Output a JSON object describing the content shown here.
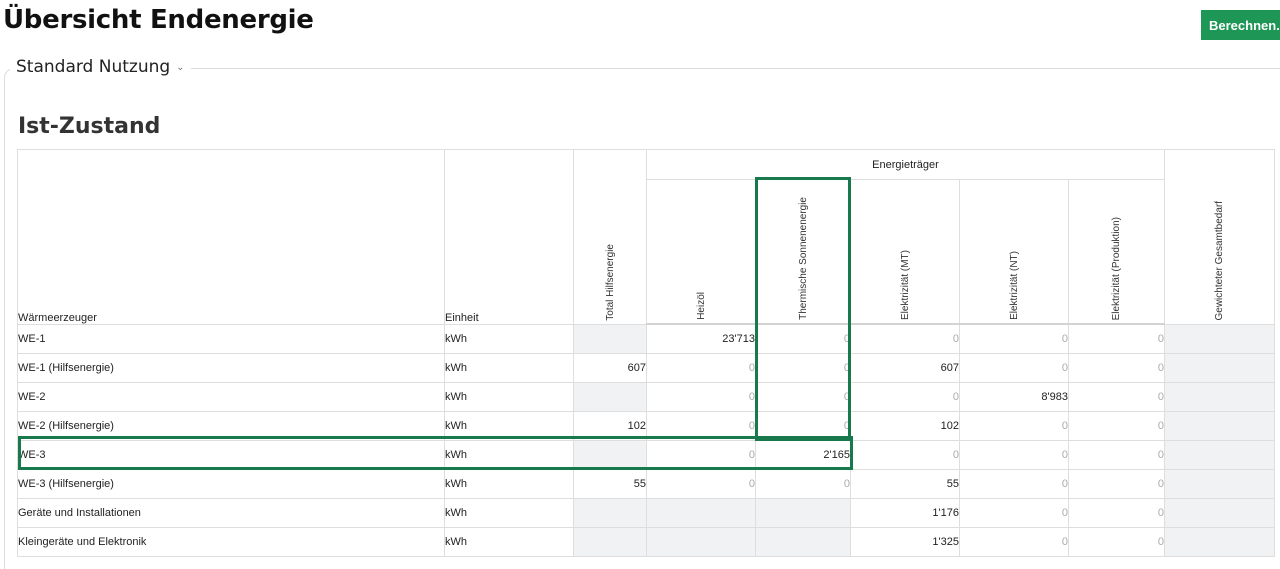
{
  "page": {
    "title": "Übersicht Endenergie"
  },
  "toolbar": {
    "calculate_label": "Berechnen..."
  },
  "usage": {
    "selected": "Standard Nutzung"
  },
  "section": {
    "title": "Ist-Zustand"
  },
  "table": {
    "headers": {
      "heat_generator": "Wärmeerzeuger",
      "unit": "Einheit",
      "total_aux": "Total Hilfsenergie",
      "group": "Energieträger",
      "heizoel": "Heizöl",
      "solar_thermal": "Thermische Sonnenenergie",
      "elec_mt": "Elektrizität (MT)",
      "elec_nt": "Elektrizität (NT)",
      "elec_prod": "Elektrizität (Produktion)",
      "weighted_total": "Gewichteter Gesamtbedarf"
    },
    "rows": [
      {
        "name": "WE-1",
        "unit": "kWh",
        "total": "",
        "heizoel": "23'713",
        "solar": "0",
        "mt": "0",
        "nt": "0",
        "prod": "0"
      },
      {
        "name": "WE-1 (Hilfsenergie)",
        "unit": "kWh",
        "total": "607",
        "heizoel": "0",
        "solar": "0",
        "mt": "607",
        "nt": "0",
        "prod": "0"
      },
      {
        "name": "WE-2",
        "unit": "kWh",
        "total": "",
        "heizoel": "0",
        "solar": "0",
        "mt": "0",
        "nt": "8'983",
        "prod": "0"
      },
      {
        "name": "WE-2 (Hilfsenergie)",
        "unit": "kWh",
        "total": "102",
        "heizoel": "0",
        "solar": "0",
        "mt": "102",
        "nt": "0",
        "prod": "0"
      },
      {
        "name": "WE-3",
        "unit": "kWh",
        "total": "",
        "heizoel": "0",
        "solar": "2'165",
        "mt": "0",
        "nt": "0",
        "prod": "0"
      },
      {
        "name": "WE-3 (Hilfsenergie)",
        "unit": "kWh",
        "total": "55",
        "heizoel": "0",
        "solar": "0",
        "mt": "55",
        "nt": "0",
        "prod": "0"
      },
      {
        "name": "Geräte und Installationen",
        "unit": "kWh",
        "total": "",
        "heizoel": "",
        "solar": "",
        "mt": "1'176",
        "nt": "0",
        "prod": "0"
      },
      {
        "name": "Kleingeräte und Elektronik",
        "unit": "kWh",
        "total": "",
        "heizoel": "",
        "solar": "",
        "mt": "1'325",
        "nt": "0",
        "prod": "0"
      }
    ]
  },
  "highlight": {
    "color": "#187a4c"
  }
}
